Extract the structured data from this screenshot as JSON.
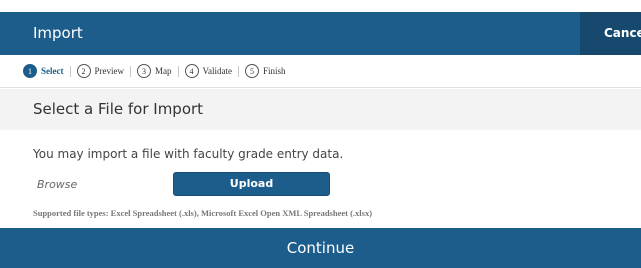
{
  "header": {
    "title": "Import",
    "cancel_label": "Cancel"
  },
  "steps": [
    {
      "number": "1",
      "label": "Select",
      "active": true
    },
    {
      "number": "2",
      "label": "Preview",
      "active": false
    },
    {
      "number": "3",
      "label": "Map",
      "active": false
    },
    {
      "number": "4",
      "label": "Validate",
      "active": false
    },
    {
      "number": "5",
      "label": "Finish",
      "active": false
    }
  ],
  "section": {
    "title": "Select a File for Import"
  },
  "body": {
    "intro": "You may import a file with faculty grade entry data.",
    "browse_placeholder": "Browse",
    "upload_label": "Upload",
    "supported_types": "Supported file types: Excel Spreadsheet (.xls), Microsoft Excel Open XML Spreadsheet (.xlsx)"
  },
  "footer": {
    "continue_label": "Continue"
  },
  "colors": {
    "primary": "#1d5d8c",
    "primary_dark": "#17496f",
    "band": "#f3f3f3"
  }
}
